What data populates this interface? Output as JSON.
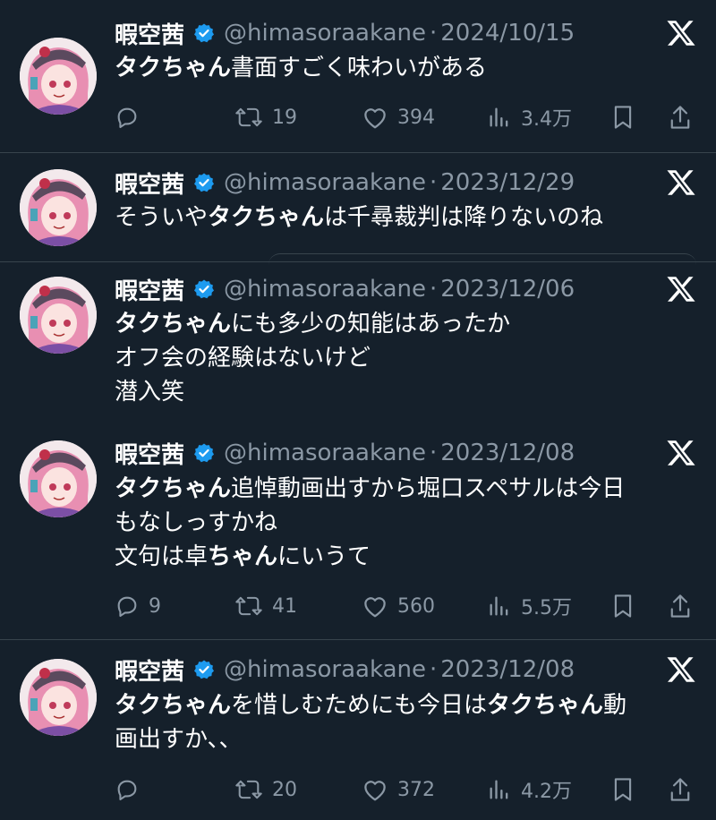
{
  "author": {
    "name": "暇空茜",
    "handle": "@himasoraakane",
    "separator": "·"
  },
  "tweets": [
    {
      "date": "2024/10/15",
      "lines": [
        [
          {
            "t": "タクちゃん",
            "b": true
          },
          {
            "t": "書面すごく味わいがある",
            "b": false
          }
        ]
      ],
      "actions": {
        "replies": "",
        "retweets": "19",
        "likes": "394",
        "views": "3.4万"
      }
    },
    {
      "date": "2023/12/29",
      "lines": [
        [
          {
            "t": "そういや",
            "b": false
          },
          {
            "t": "タクちゃん",
            "b": true
          },
          {
            "t": "は千尋裁判は降りないのね",
            "b": false
          }
        ]
      ]
    },
    {
      "date": "2023/12/06",
      "lines": [
        [
          {
            "t": "タクちゃん",
            "b": true
          },
          {
            "t": "にも多少の知能はあったか",
            "b": false
          }
        ],
        [
          {
            "t": "オフ会の経験はないけど",
            "b": false
          }
        ],
        [
          {
            "t": "潜入笑",
            "b": false
          }
        ]
      ]
    },
    {
      "date": "2023/12/08",
      "lines": [
        [
          {
            "t": "タクちゃん",
            "b": true
          },
          {
            "t": "追悼動画出すから堀口スペサルは今日",
            "b": false
          }
        ],
        [
          {
            "t": "もなしっすかね",
            "b": false
          }
        ],
        [
          {
            "t": "文句は卓",
            "b": false
          },
          {
            "t": "ちゃん",
            "b": true
          },
          {
            "t": "にいうて",
            "b": false
          }
        ]
      ],
      "actions": {
        "replies": "9",
        "retweets": "41",
        "likes": "560",
        "views": "5.5万"
      }
    },
    {
      "date": "2023/12/08",
      "lines": [
        [
          {
            "t": "タクちゃん",
            "b": true
          },
          {
            "t": "を惜しむためにも今日は",
            "b": false
          },
          {
            "t": "タクちゃん",
            "b": true
          },
          {
            "t": "動",
            "b": false
          }
        ],
        [
          {
            "t": "画出すか、、",
            "b": false
          }
        ]
      ],
      "actions": {
        "replies": "",
        "retweets": "20",
        "likes": "372",
        "views": "4.2万"
      }
    }
  ],
  "icons": {
    "badge": "verified-badge-icon",
    "x": "x-logo-icon",
    "reply": "reply-icon",
    "retweet": "retweet-icon",
    "like": "like-icon",
    "views": "views-icon",
    "bookmark": "bookmark-icon",
    "share": "share-icon"
  },
  "colors": {
    "background": "#15202b",
    "text": "#ffffff",
    "muted": "#8b98a5",
    "verified": "#1d9bf0",
    "divider": "#38444d"
  }
}
